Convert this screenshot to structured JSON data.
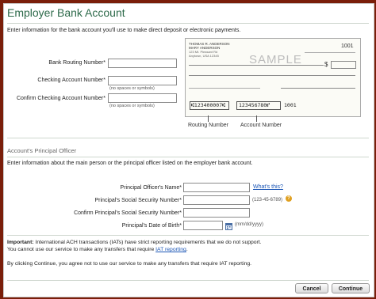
{
  "page": {
    "title": "Employer Bank Account",
    "intro": "Enter information for the bank account you'll use to make direct deposit or electronic payments."
  },
  "bank_form": {
    "routing_label": "Bank Routing Number*",
    "checking_label": "Checking Account Number*",
    "checking_hint": "(no spaces or symbols)",
    "confirm_label": "Confirm Checking Account Number*",
    "confirm_hint": "(no spaces or symbols)"
  },
  "check_image": {
    "name_line1": "THOMAS R. ANDERSON",
    "name_line2": "MARY ANDERSON",
    "address_line1": "123 Mt. Pleasant Rd",
    "address_line2": "Anytown, USA 12345",
    "check_number": "1001",
    "watermark": "SAMPLE",
    "dollar_sign": "$",
    "micr_routing": "⑆123400007⑆",
    "micr_account": "123456780⑈",
    "micr_check": "1001",
    "routing_caption": "Routing Number",
    "account_caption": "Account Number"
  },
  "officer_section": {
    "heading": "Account's Principal Officer",
    "intro": "Enter information about the main person or the principal officer listed on the employer bank account.",
    "name_label": "Principal Officer's Name*",
    "whats_this": "What's this?",
    "ssn_label": "Principal's Social Security Number*",
    "ssn_hint": "(123-45-6789)",
    "confirm_ssn_label": "Confirm Principal's Social Security Number*",
    "dob_label": "Principal's Date of Birth*",
    "dob_hint": "(mm/dd/yyyy)"
  },
  "notice": {
    "important_label": "Important:",
    "line1": " International ACH transactions (IATs) have strict reporting requirements that we do not support.",
    "line2_prefix": "You cannot use our service to make any transfers that require ",
    "line2_link": "IAT reporting",
    "line2_suffix": ".",
    "agreement": "By clicking Continue, you agree not to use our service to make any transfers that require IAT reporting."
  },
  "buttons": {
    "cancel": "Cancel",
    "continue": "Continue"
  },
  "colors": {
    "frame": "#7a1e0a",
    "title": "#2d6a4a",
    "link": "#1a55b5",
    "help_icon": "#e0a020"
  },
  "icons": {
    "help": "question-circle-icon",
    "calendar": "calendar-icon"
  }
}
